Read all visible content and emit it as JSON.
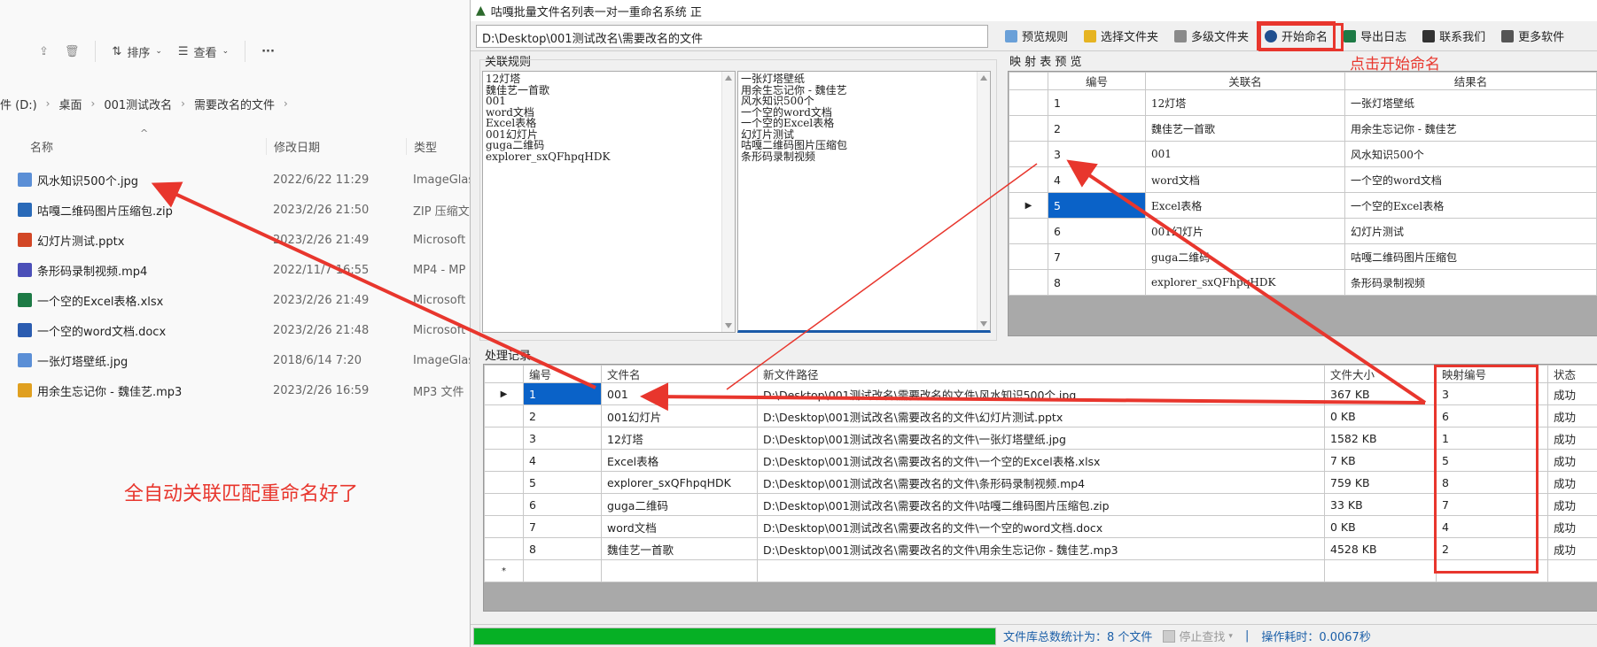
{
  "explorer": {
    "toolbar": {
      "sort_label": "排序",
      "view_label": "查看",
      "more_label": "···"
    },
    "breadcrumb": [
      "件 (D:)",
      "桌面",
      "001测试改名",
      "需要改名的文件"
    ],
    "columns": {
      "name": "名称",
      "date": "修改日期",
      "type": "类型"
    },
    "files": [
      {
        "name": "风水知识500个.jpg",
        "date": "2022/6/22 11:29",
        "type": "ImageGlass",
        "icon": "image-file-icon",
        "color": "#5b8fd6"
      },
      {
        "name": "咕嘎二维码图片压缩包.zip",
        "date": "2023/2/26 21:50",
        "type": "ZIP 压缩文件",
        "icon": "zip-file-icon",
        "color": "#2a6ab8"
      },
      {
        "name": "幻灯片测试.pptx",
        "date": "2023/2/26 21:49",
        "type": "Microsoft",
        "icon": "pptx-file-icon",
        "color": "#d24726"
      },
      {
        "name": "条形码录制视频.mp4",
        "date": "2022/11/7 16:55",
        "type": "MP4 - MP",
        "icon": "video-file-icon",
        "color": "#4b4fb8"
      },
      {
        "name": "一个空的Excel表格.xlsx",
        "date": "2023/2/26 21:49",
        "type": "Microsoft",
        "icon": "xlsx-file-icon",
        "color": "#1d7a45"
      },
      {
        "name": "一个空的word文档.docx",
        "date": "2023/2/26 21:48",
        "type": "Microsoft",
        "icon": "docx-file-icon",
        "color": "#2b5cb0"
      },
      {
        "name": "一张灯塔壁纸.jpg",
        "date": "2018/6/14 7:20",
        "type": "ImageGlass",
        "icon": "image-file-icon",
        "color": "#5b8fd6"
      },
      {
        "name": "用余生忘记你 - 魏佳艺.mp3",
        "date": "2023/2/26 16:59",
        "type": "MP3 文件",
        "icon": "audio-file-icon",
        "color": "#e0a020"
      }
    ],
    "annotation": "全自动关联匹配重命名好了"
  },
  "app": {
    "title": "咕嘎批量文件名列表一对一重命名系统  正",
    "path": "D:\\Desktop\\001测试改名\\需要改名的文件",
    "tools": [
      {
        "label": "预览规则",
        "icon": "preview-icon",
        "color": "#6aa0d8"
      },
      {
        "label": "选择文件夹",
        "icon": "folder-icon",
        "color": "#e6b422"
      },
      {
        "label": "多级文件夹",
        "icon": "multi-folder-icon",
        "color": "#8a8a8a"
      },
      {
        "label": "开始命名",
        "icon": "start-icon",
        "color": "#1f4f8f"
      },
      {
        "label": "导出日志",
        "icon": "excel-export-icon",
        "color": "#1d7a45"
      },
      {
        "label": "联系我们",
        "icon": "contact-icon",
        "color": "#333333"
      },
      {
        "label": "更多软件",
        "icon": "grid-icon",
        "color": "#555555"
      }
    ],
    "start_annotation": "点击开始命名",
    "rules": {
      "title": "关联规则",
      "left": "12灯塔\n魏佳艺一首歌\n001\nword文档\nExcel表格\n001幻灯片\nguga二维码\nexplorer_sxQFhpqHDK",
      "right": "一张灯塔壁纸\n用余生忘记你 - 魏佳艺\n风水知识500个\n一个空的word文档\n一个空的Excel表格\n幻灯片测试\n咕嘎二维码图片压缩包\n条形码录制视频"
    },
    "mapping": {
      "title": "映 射 表 预 览",
      "columns": [
        "编号",
        "关联名",
        "结果名"
      ],
      "rows": [
        [
          "1",
          "12灯塔",
          "一张灯塔壁纸"
        ],
        [
          "2",
          "魏佳艺一首歌",
          "用余生忘记你 - 魏佳艺"
        ],
        [
          "3",
          "001",
          "风水知识500个"
        ],
        [
          "4",
          "word文档",
          "一个空的word文档"
        ],
        [
          "5",
          "Excel表格",
          "一个空的Excel表格"
        ],
        [
          "6",
          "001幻灯片",
          "幻灯片测试"
        ],
        [
          "7",
          "guga二维码",
          "咕嘎二维码图片压缩包"
        ],
        [
          "8",
          "explorer_sxQFhpqHDK",
          "条形码录制视频"
        ]
      ]
    },
    "process": {
      "title": "处理记录",
      "columns": [
        "编号",
        "文件名",
        "新文件路径",
        "文件大小",
        "映射编号",
        "状态"
      ],
      "rows": [
        [
          "1",
          "001",
          "D:\\Desktop\\001测试改名\\需要改名的文件\\风水知识500个.jpg",
          "367 KB",
          "3",
          "成功"
        ],
        [
          "2",
          "001幻灯片",
          "D:\\Desktop\\001测试改名\\需要改名的文件\\幻灯片测试.pptx",
          "0 KB",
          "6",
          "成功"
        ],
        [
          "3",
          "12灯塔",
          "D:\\Desktop\\001测试改名\\需要改名的文件\\一张灯塔壁纸.jpg",
          "1582 KB",
          "1",
          "成功"
        ],
        [
          "4",
          "Excel表格",
          "D:\\Desktop\\001测试改名\\需要改名的文件\\一个空的Excel表格.xlsx",
          "7 KB",
          "5",
          "成功"
        ],
        [
          "5",
          "explorer_sxQFhpqHDK",
          "D:\\Desktop\\001测试改名\\需要改名的文件\\条形码录制视频.mp4",
          "759 KB",
          "8",
          "成功"
        ],
        [
          "6",
          "guga二维码",
          "D:\\Desktop\\001测试改名\\需要改名的文件\\咕嘎二维码图片压缩包.zip",
          "33 KB",
          "7",
          "成功"
        ],
        [
          "7",
          "word文档",
          "D:\\Desktop\\001测试改名\\需要改名的文件\\一个空的word文档.docx",
          "0 KB",
          "4",
          "成功"
        ],
        [
          "8",
          "魏佳艺一首歌",
          "D:\\Desktop\\001测试改名\\需要改名的文件\\用余生忘记你 - 魏佳艺.mp3",
          "4528 KB",
          "2",
          "成功"
        ]
      ]
    },
    "status": {
      "progress": 1.0,
      "count_text": "文件库总数统计为：8 个文件",
      "stop_label": "停止查找",
      "time_text": "操作耗时：0.0067秒"
    },
    "colors": {
      "accent": "#e8362d",
      "selection": "#0a62c8",
      "progress": "#06b025"
    }
  }
}
